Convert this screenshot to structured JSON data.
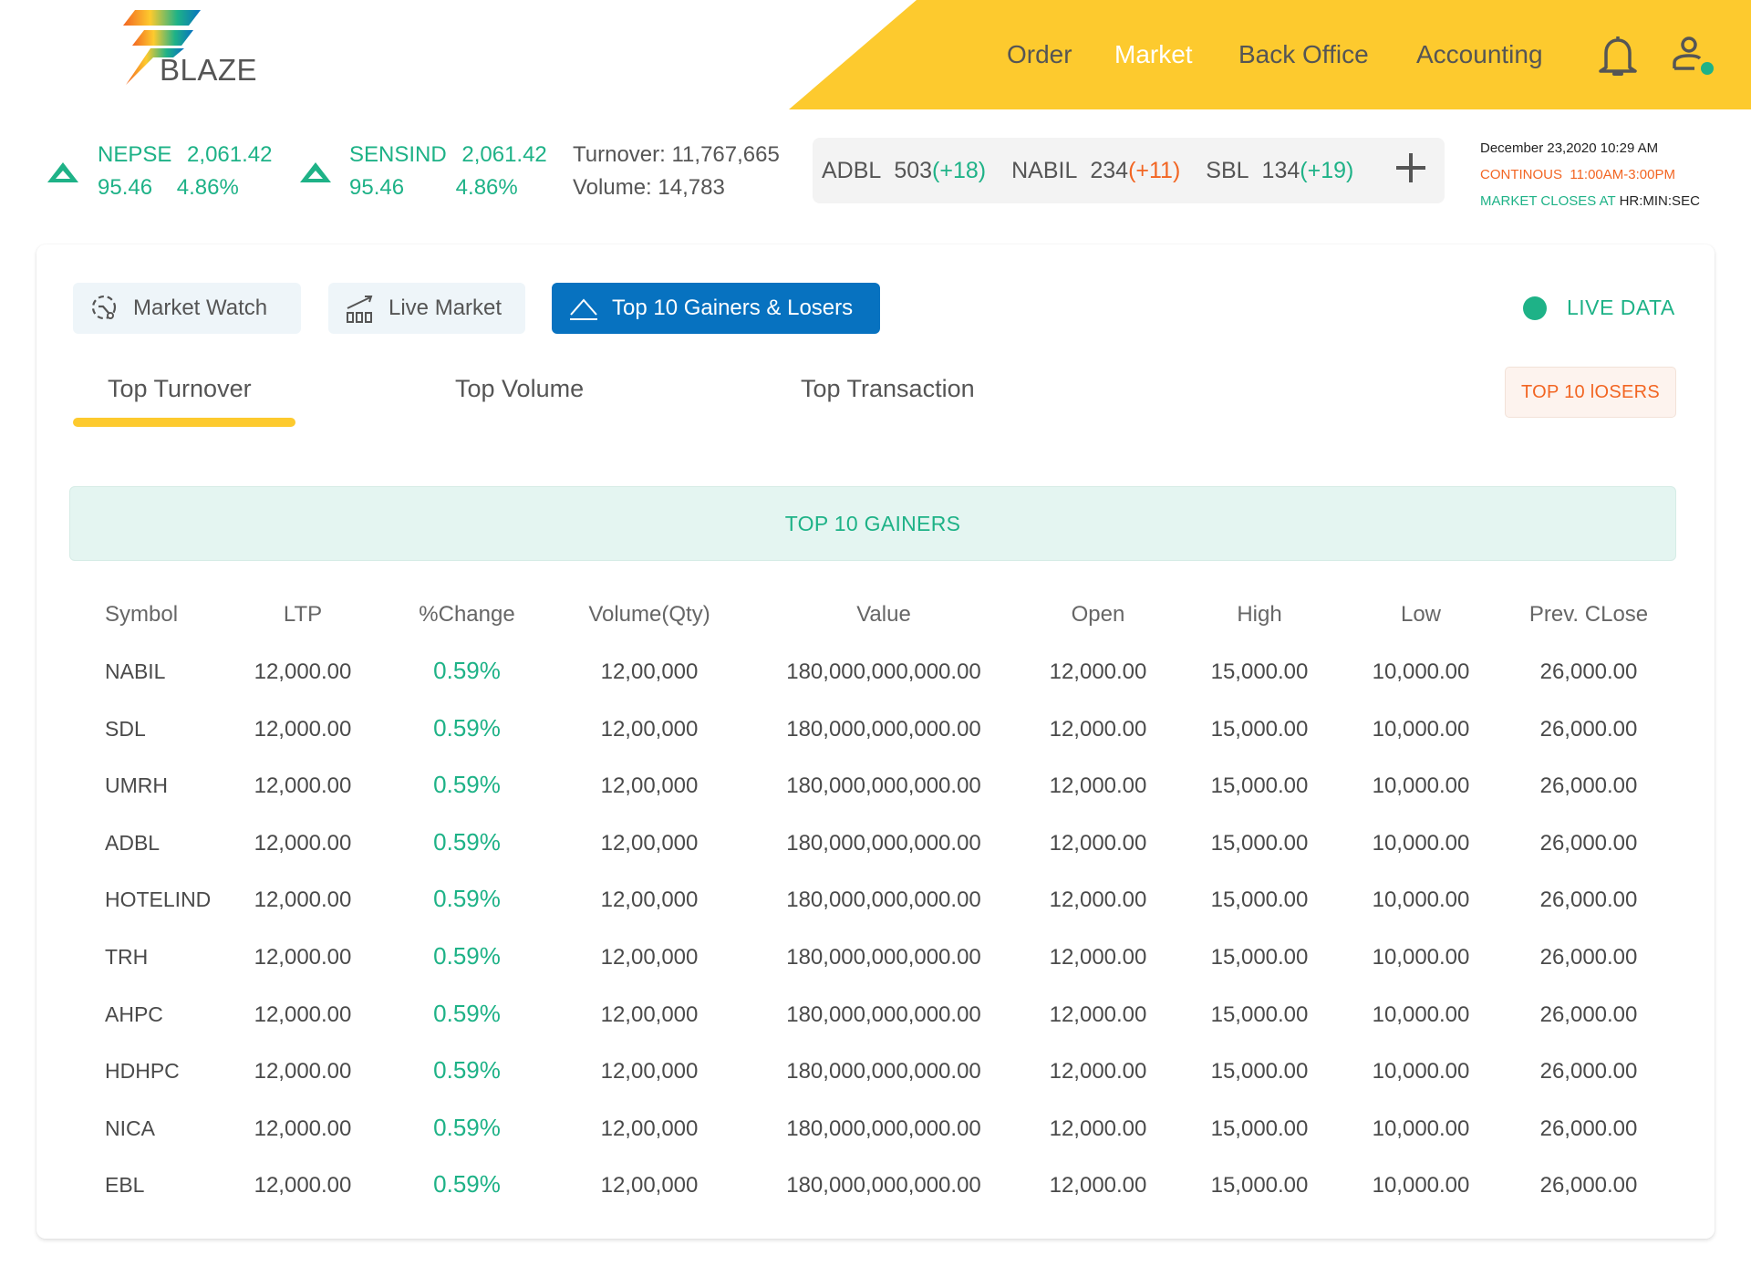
{
  "brand": {
    "name": "BLAZE"
  },
  "nav": {
    "items": [
      {
        "label": "Order",
        "active": false
      },
      {
        "label": "Market",
        "active": true
      },
      {
        "label": "Back Office",
        "active": false
      },
      {
        "label": "Accounting",
        "active": false
      }
    ],
    "icons": {
      "notifications": "bell-icon",
      "profile": "user-icon",
      "online_status_color": "#1eb287"
    }
  },
  "indices": [
    {
      "name": "NEPSE",
      "value": "2,061.42",
      "change": "95.46",
      "percent": "4.86%",
      "direction": "up"
    },
    {
      "name": "SENSIND",
      "value": "2,061.42",
      "change": "95.46",
      "percent": "4.86%",
      "direction": "up"
    }
  ],
  "market_stats": {
    "turnover_label": "Turnover:",
    "turnover": "11,767,665",
    "volume_label": "Volume:",
    "volume": "14,783"
  },
  "ticker": [
    {
      "symbol": "ADBL",
      "price": "503",
      "change": "(+18)",
      "trend": "up"
    },
    {
      "symbol": "NABIL",
      "price": "234",
      "change": "(+11)",
      "trend": "down"
    },
    {
      "symbol": "SBL",
      "price": "134",
      "change": "(+19)",
      "trend": "up"
    }
  ],
  "clock": {
    "datetime": "December 23,2020 10:29 AM",
    "session": "CONTINOUS  11:00AM-3:00PM",
    "closes_label": "MARKET CLOSES AT",
    "closes_value": "HR:MIN:SEC"
  },
  "views": [
    {
      "label": "Market Watch",
      "icon": "market-watch-icon",
      "active": false
    },
    {
      "label": "Live Market",
      "icon": "bar-chart-trend-icon",
      "active": false
    },
    {
      "label": "Top 10 Gainers & Losers",
      "icon": "triangle-up-icon",
      "active": true
    }
  ],
  "live": {
    "label": "LIVE DATA"
  },
  "tabs": [
    {
      "label": "Top Turnover",
      "active": true
    },
    {
      "label": "Top Volume",
      "active": false
    },
    {
      "label": "Top Transaction",
      "active": false
    }
  ],
  "losers_button": "TOP 10 lOSERS",
  "gainers_title": "TOP 10 GAINERS",
  "table": {
    "columns": [
      "Symbol",
      "LTP",
      "%Change",
      "Volume(Qty)",
      "Value",
      "Open",
      "High",
      "Low",
      "Prev. CLose"
    ],
    "rows": [
      [
        "NABIL",
        "12,000.00",
        "0.59%",
        "12,00,000",
        "180,000,000,000.00",
        "12,000.00",
        "15,000.00",
        "10,000.00",
        "26,000.00"
      ],
      [
        "SDL",
        "12,000.00",
        "0.59%",
        "12,00,000",
        "180,000,000,000.00",
        "12,000.00",
        "15,000.00",
        "10,000.00",
        "26,000.00"
      ],
      [
        "UMRH",
        "12,000.00",
        "0.59%",
        "12,00,000",
        "180,000,000,000.00",
        "12,000.00",
        "15,000.00",
        "10,000.00",
        "26,000.00"
      ],
      [
        "ADBL",
        "12,000.00",
        "0.59%",
        "12,00,000",
        "180,000,000,000.00",
        "12,000.00",
        "15,000.00",
        "10,000.00",
        "26,000.00"
      ],
      [
        "HOTELIND",
        "12,000.00",
        "0.59%",
        "12,00,000",
        "180,000,000,000.00",
        "12,000.00",
        "15,000.00",
        "10,000.00",
        "26,000.00"
      ],
      [
        "TRH",
        "12,000.00",
        "0.59%",
        "12,00,000",
        "180,000,000,000.00",
        "12,000.00",
        "15,000.00",
        "10,000.00",
        "26,000.00"
      ],
      [
        "AHPC",
        "12,000.00",
        "0.59%",
        "12,00,000",
        "180,000,000,000.00",
        "12,000.00",
        "15,000.00",
        "10,000.00",
        "26,000.00"
      ],
      [
        "HDHPC",
        "12,000.00",
        "0.59%",
        "12,00,000",
        "180,000,000,000.00",
        "12,000.00",
        "15,000.00",
        "10,000.00",
        "26,000.00"
      ],
      [
        "NICA",
        "12,000.00",
        "0.59%",
        "12,00,000",
        "180,000,000,000.00",
        "12,000.00",
        "15,000.00",
        "10,000.00",
        "26,000.00"
      ],
      [
        "EBL",
        "12,000.00",
        "0.59%",
        "12,00,000",
        "180,000,000,000.00",
        "12,000.00",
        "15,000.00",
        "10,000.00",
        "26,000.00"
      ]
    ]
  },
  "colors": {
    "brand_yellow": "#fdca2e",
    "gain_green": "#1eb287",
    "loss_orange": "#f26522",
    "primary_blue": "#0772c0"
  }
}
